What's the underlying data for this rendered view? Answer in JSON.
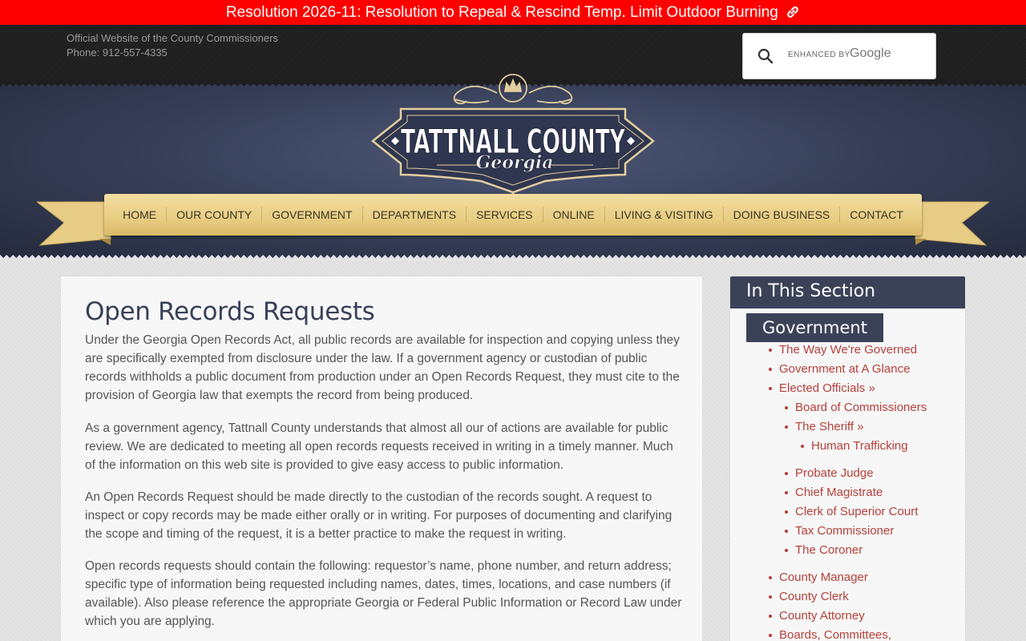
{
  "alert": {
    "text": "Resolution 2026-11: Resolution to Repeal & Rescind Temp. Limit Outdoor Burning",
    "icon": "link-icon"
  },
  "top": {
    "tagline": "Official Website of the County Commissioners",
    "phone": "Phone: 912-557-4335"
  },
  "search": {
    "enhanced_label": "ENHANCED BY",
    "google_label": "Google",
    "placeholder": ""
  },
  "logo": {
    "title": "TATTNALL COUNTY",
    "subtitle": "Georgia"
  },
  "nav": [
    "HOME",
    "OUR COUNTY",
    "GOVERNMENT",
    "DEPARTMENTS",
    "SERVICES",
    "ONLINE",
    "LIVING & VISITING",
    "DOING BUSINESS",
    "CONTACT"
  ],
  "main": {
    "title": "Open Records Requests",
    "paragraphs": [
      "Under the Georgia Open Records Act, all public records are available for inspection and copying unless they are specifically exempted from disclosure under the law.  If a government agency or custodian of public records withholds a public document from production under an Open Records Request, they must cite to the provision of Georgia law that exempts the record from being produced.",
      "As a government agency, Tattnall County understands that almost all our of actions are available for public review. We are dedicated to meeting all open records requests received in writing in a timely manner. Much of the information on this web site is provided to give easy access to public information.",
      "An Open Records Request should be made directly to the custodian of the records sought. A request to inspect or copy records may be made either orally or in writing. For purposes of documenting and clarifying the scope and timing of the request, it is a better practice to make the request in writing.",
      "Open records requests should contain the following: requestor’s name, phone number, and return address; specific type of information being requested including names, dates, times, locations, and case numbers (if available). Also please reference the appropriate Georgia or Federal Public Information or Record Law under which you are applying."
    ]
  },
  "sidebar": {
    "heading": "In This Section",
    "section": "Government",
    "items": [
      "The Way We're Governed",
      "Government at A Glance",
      "Elected Officials »",
      "Board of Commissioners",
      "The Sheriff »",
      "Human Trafficking",
      "Probate Judge",
      "Chief Magistrate",
      "Clerk of Superior Court",
      "Tax Commissioner",
      "The Coroner",
      "County Manager",
      "County Clerk",
      "County Attorney",
      "Boards, Committees,"
    ]
  },
  "colors": {
    "alert": "#ff0000",
    "navy": "#3b4258",
    "link": "#b4403b",
    "ribbon": "#e8cd82"
  }
}
